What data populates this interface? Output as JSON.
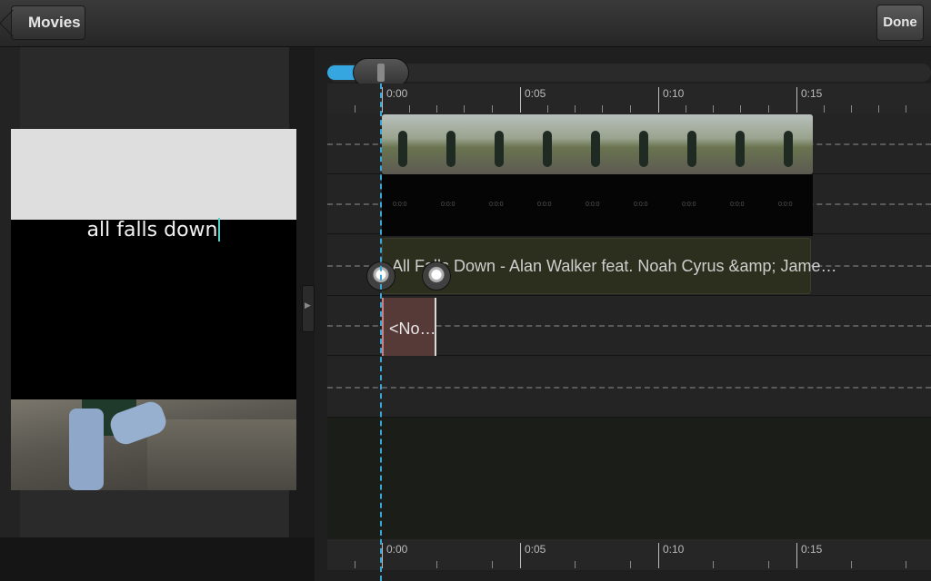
{
  "header": {
    "back_label": "Movies",
    "done_label": "Done"
  },
  "preview": {
    "caption_text": "all falls down"
  },
  "timeline": {
    "ruler_labels": [
      "0:00",
      "0:05",
      "0:10",
      "0:15"
    ],
    "music_clip_label": "All Falls Down - Alan Walker feat. Noah Cyrus &amp; Jame…",
    "text_clip_label": "<No…",
    "audio_marks": [
      "0:0:0",
      "0:0:0",
      "0:0:0",
      "0:0:0",
      "0:0:0",
      "0:0:0",
      "0:0:0",
      "0:0:0",
      "0:0:0"
    ]
  },
  "colors": {
    "accent": "#35a6e0",
    "text_clip": "#563a38",
    "music_clip": "#2d2f1e"
  }
}
